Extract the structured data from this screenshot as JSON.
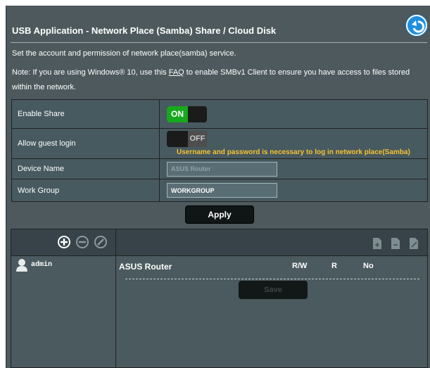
{
  "header": {
    "title": "USB Application - Network Place (Samba) Share / Cloud Disk",
    "back_icon": "back-arrow-icon"
  },
  "description": "Set the account and permission of network place(samba) service.",
  "note": {
    "prefix": "Note: If you are using Windows® 10, use this ",
    "link": "FAQ",
    "suffix": " to enable SMBv1 Client to ensure you have access to files stored within the network."
  },
  "settings": {
    "enable_share": {
      "label": "Enable Share",
      "value": "ON",
      "state": true
    },
    "guest_login": {
      "label": "Allow guest login",
      "value": "OFF",
      "state": false,
      "hint": "Username and password is necessary to log in network place(Samba)"
    },
    "device_name": {
      "label": "Device Name",
      "value": "ASUS Router"
    },
    "work_group": {
      "label": "Work Group",
      "value": "WORKGROUP"
    }
  },
  "apply_label": "Apply",
  "accounts": {
    "toolbar_icons": [
      "add-circle-icon",
      "remove-circle-icon",
      "edit-circle-icon"
    ],
    "folder_icons": [
      "new-folder-icon",
      "delete-folder-icon",
      "edit-folder-icon"
    ],
    "users": [
      "admin"
    ],
    "shares": [
      {
        "name": "ASUS Router",
        "rw": "R/W",
        "r": "R",
        "no": "No"
      }
    ],
    "save_label": "Save"
  },
  "colors": {
    "panel_bg": "#4d595d",
    "toggle_on": "#18a81d",
    "hint": "#f6c133",
    "back_button": "#1f8fe0"
  }
}
